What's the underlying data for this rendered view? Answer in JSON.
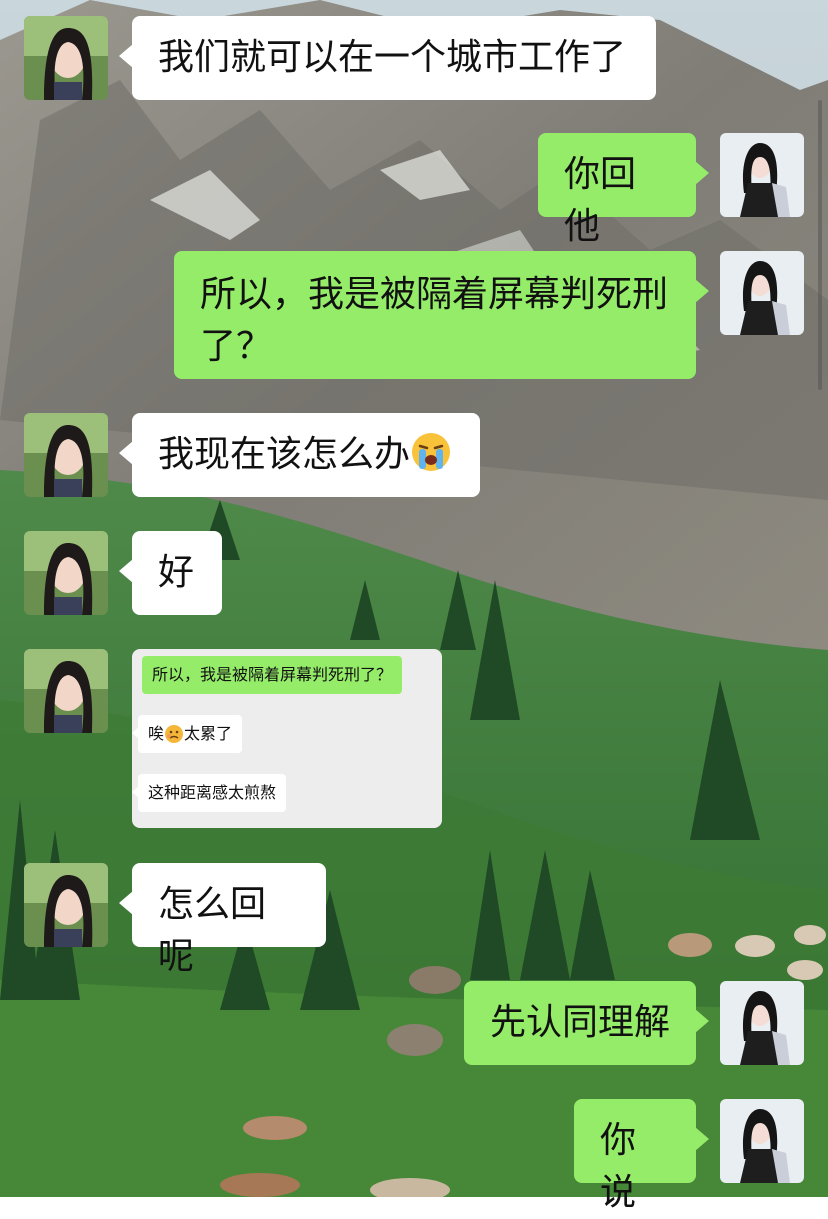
{
  "colors": {
    "self_bubble": "#95ec69",
    "other_bubble": "#ffffff",
    "quote_card": "#ededed"
  },
  "messages": [
    {
      "from": "other",
      "text": "我们就可以在一个城市工作了"
    },
    {
      "from": "self",
      "text": "你回他"
    },
    {
      "from": "self",
      "text": "所以，我是被隔着屏幕判死刑了？"
    },
    {
      "from": "other",
      "text": "我现在该怎么办",
      "emoji": "crying-face-icon"
    },
    {
      "from": "other",
      "text": "好"
    },
    {
      "from": "other",
      "type": "screenshot",
      "items": [
        {
          "from": "self",
          "text": "所以，我是被隔着屏幕判死刑了？"
        },
        {
          "from": "other",
          "text_before": "唉",
          "emoji": "sad-face-icon",
          "text_after": "太累了"
        },
        {
          "from": "other",
          "text": "这种距离感太煎熬"
        }
      ]
    },
    {
      "from": "other",
      "text": "怎么回呢"
    },
    {
      "from": "self",
      "text": "先认同理解"
    },
    {
      "from": "self",
      "text": "你说"
    }
  ]
}
